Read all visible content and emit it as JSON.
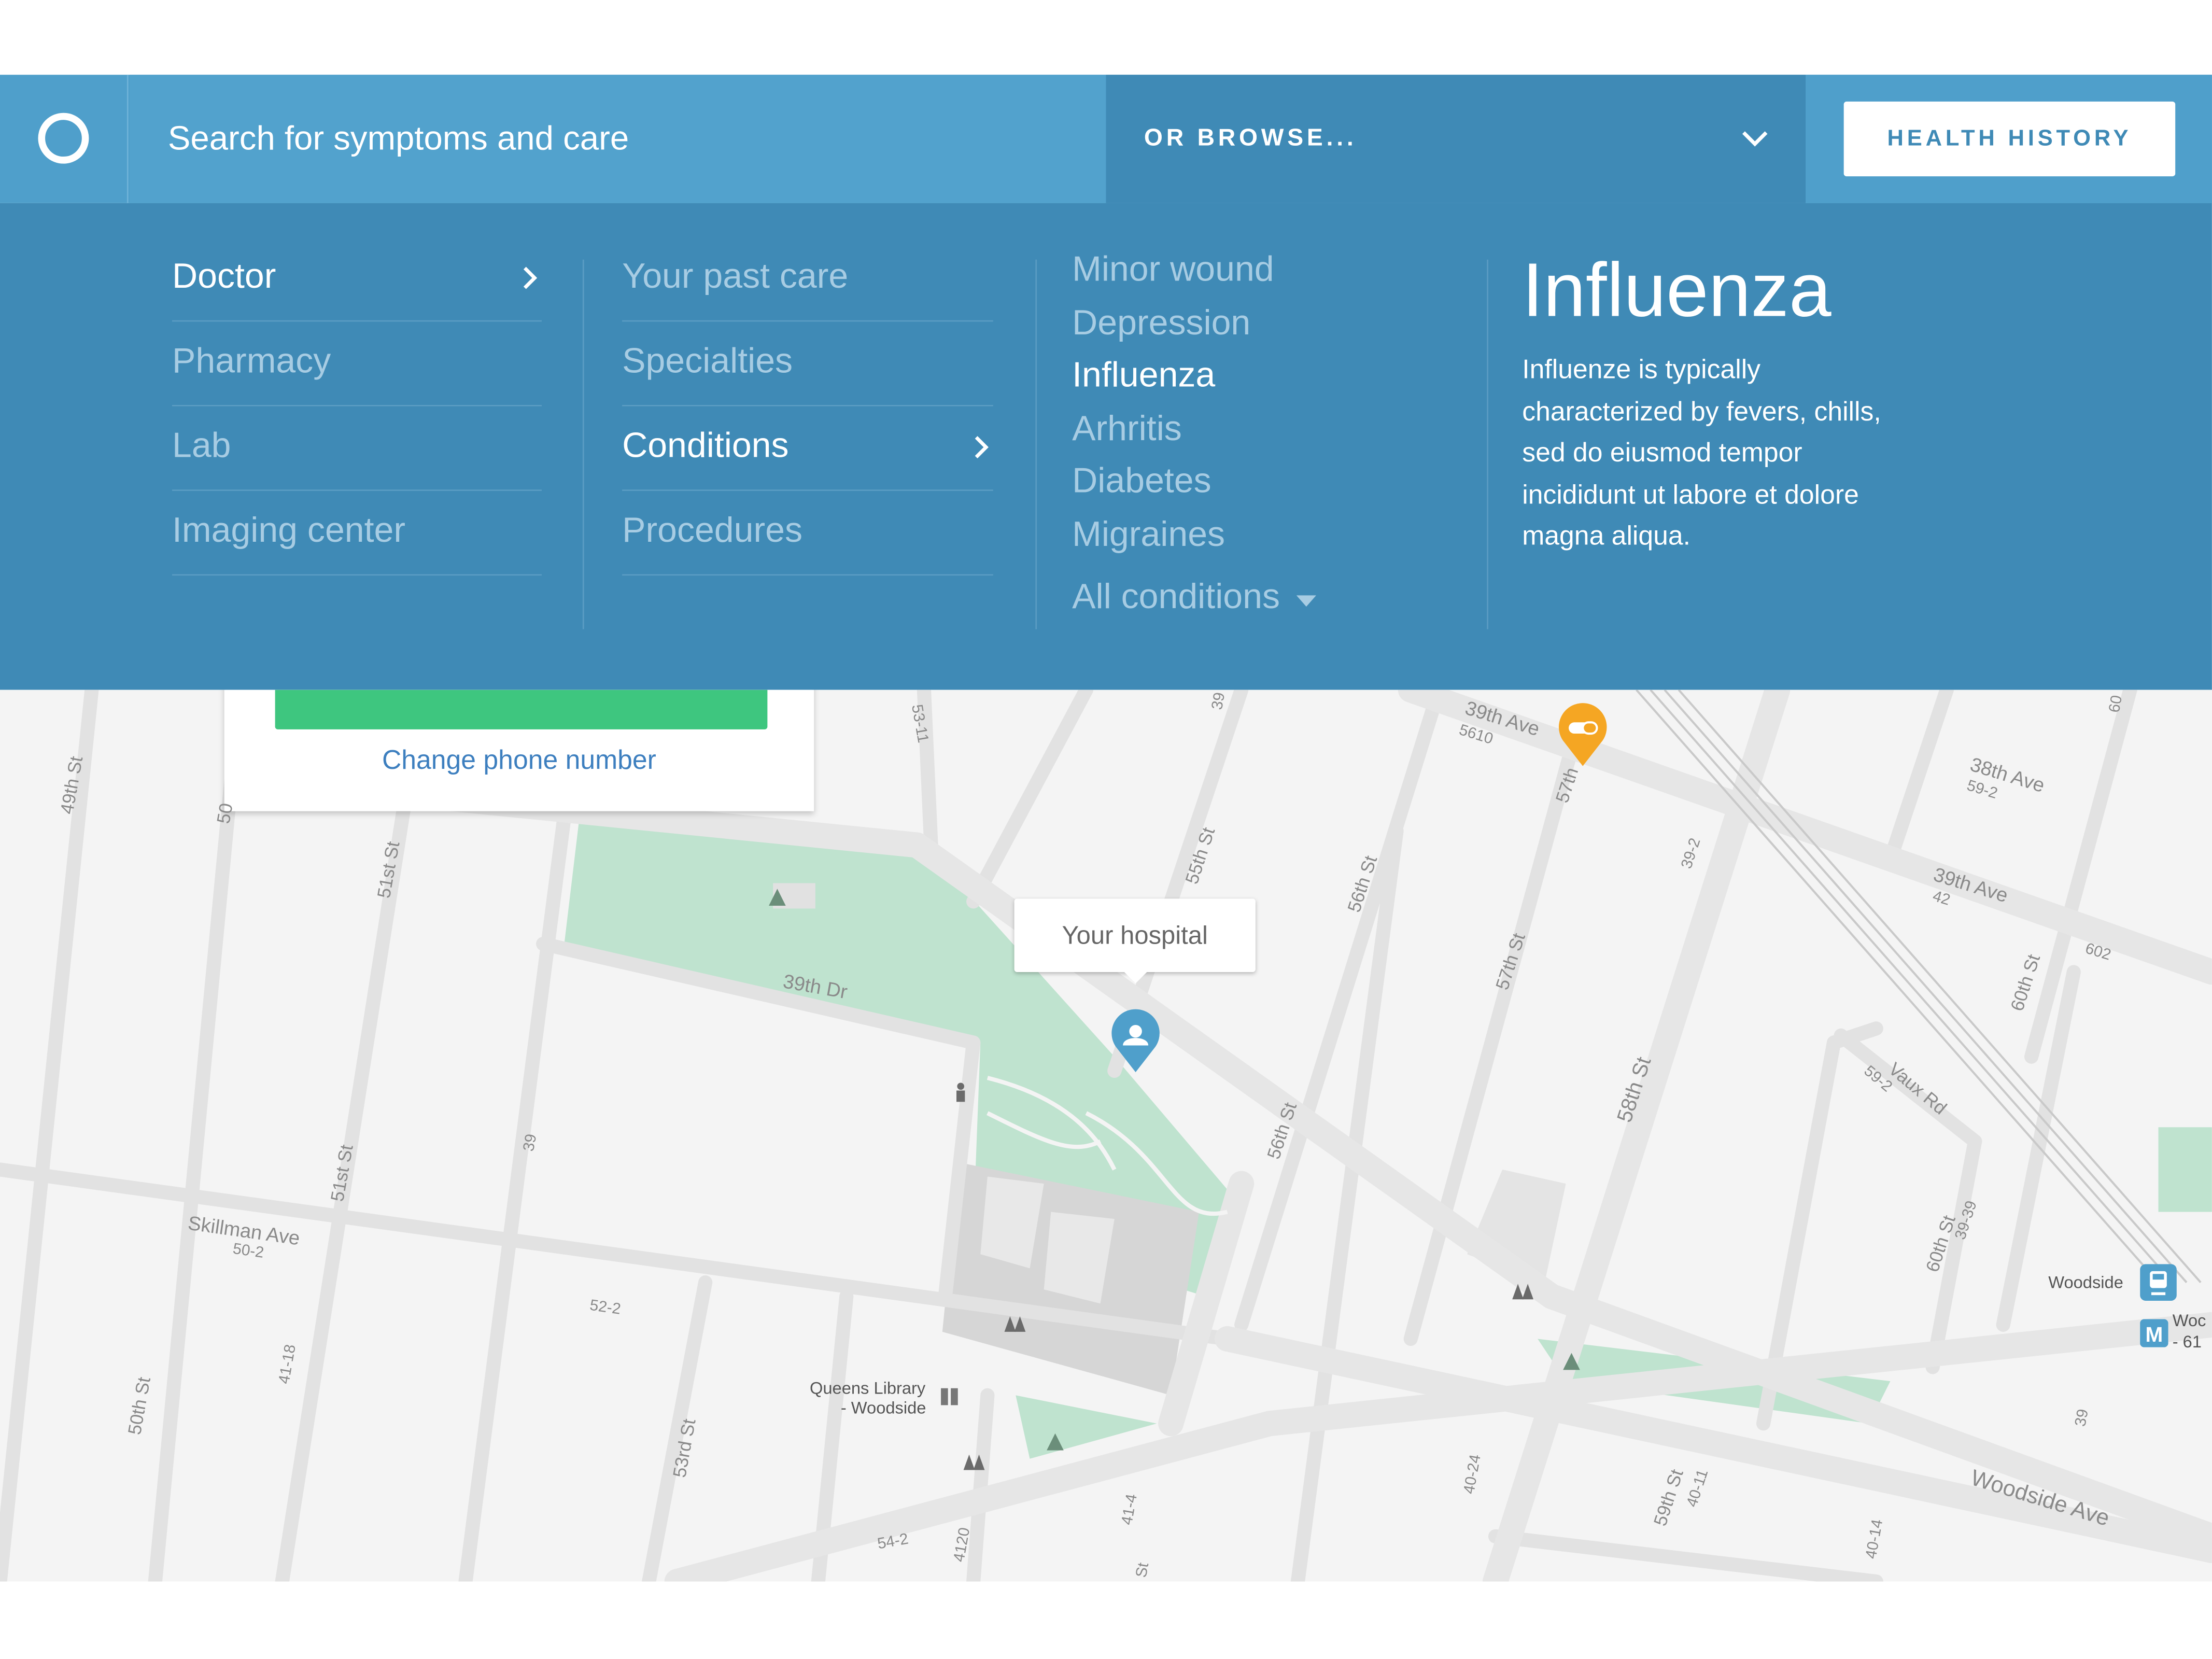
{
  "header": {
    "logo_icon": "ring-logo-icon",
    "search_placeholder": "Search for symptoms and care",
    "browse_label": "OR BROWSE...",
    "browse_icon": "chevron-down-icon",
    "health_history_label": "HEALTH HISTORY"
  },
  "menu": {
    "column1": [
      {
        "label": "Doctor",
        "active": true
      },
      {
        "label": "Pharmacy"
      },
      {
        "label": "Lab"
      },
      {
        "label": "Imaging center"
      }
    ],
    "column2": [
      {
        "label": "Your past care"
      },
      {
        "label": "Specialties"
      },
      {
        "label": "Conditions",
        "active": true
      },
      {
        "label": "Procedures"
      }
    ],
    "conditions": [
      "Minor wound",
      "Depression",
      "Influenza",
      "Arhritis",
      "Diabetes",
      "Migraines"
    ],
    "selected_condition": "Influenza",
    "all_conditions_label": "All conditions"
  },
  "detail": {
    "title": "Influenza",
    "description": "Influenze is typically characterized by fevers, chills, sed do eiusmod tempor incididunt ut labore et dolore magna aliqua."
  },
  "call_card": {
    "change_phone_label": "Change phone number"
  },
  "map": {
    "tooltip": "Your hospital",
    "pin_icon": "person-pin-icon",
    "pharmacy_pin_icon": "pill-pin-icon",
    "labels": {
      "l49th": "49th St",
      "l50th_a": "50",
      "l51st_a": "51st St",
      "l51st_b": "51st St",
      "l50th_b": "50th St",
      "l53rd": "53rd St",
      "l55th": "55th St",
      "l56th_a": "56th St",
      "l56th_b": "56th St",
      "l57th_a": "57th",
      "l57th_b": "57th St",
      "l58th": "58th St",
      "l59th": "59th St",
      "l60th_a": "60th St",
      "l60th_b": "60th St",
      "l39th_ave_a": "39th Ave",
      "l39th_ave_b": "39th Ave",
      "l38th_ave": "38th Ave",
      "l39th_dr": "39th Dr",
      "skillman": "Skillman Ave",
      "woodside_ave": "Woodside Ave",
      "vaux": "Vaux Rd",
      "library": "Queens Library",
      "library2": "- Woodside",
      "woodside_station": "Woodside",
      "n5610": "5610",
      "n592a": "59-2",
      "n592b": "59-2",
      "n42": "42",
      "n602": "602",
      "n392": "39-2",
      "n502": "50-2",
      "n522": "52-2",
      "n542": "54-2",
      "n4120": "4120",
      "n414": "41-4",
      "n4024": "40-24",
      "n4014": "40-14",
      "n4011": "40-11",
      "n3939": "39-39",
      "n39a": "39",
      "n39b": "39",
      "n4118": "41-18",
      "n5311": "53-11",
      "n39c": "39",
      "n60": "60",
      "st": "St",
      "woc": "Woc",
      "n61": "- 61"
    }
  }
}
